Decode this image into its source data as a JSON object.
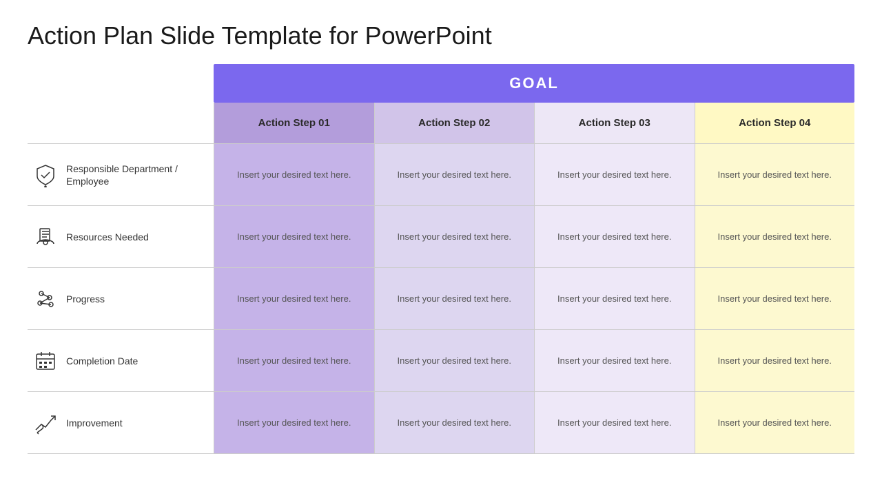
{
  "title": "Action Plan Slide Template for PowerPoint",
  "goal_label": "GOAL",
  "columns": [
    {
      "label": "Action Step 01"
    },
    {
      "label": "Action Step 02"
    },
    {
      "label": "Action Step 03"
    },
    {
      "label": "Action Step 04"
    }
  ],
  "rows": [
    {
      "label": "Responsible Department / Employee",
      "icon": "shield",
      "cells": [
        "Insert your desired text here.",
        "Insert your desired text here.",
        "Insert your desired text here.",
        "Insert your desired text here."
      ]
    },
    {
      "label": "Resources Needed",
      "icon": "resources",
      "cells": [
        "Insert your desired text here.",
        "Insert your desired text here.",
        "Insert your desired text here.",
        "Insert your desired text here."
      ]
    },
    {
      "label": "Progress",
      "icon": "progress",
      "cells": [
        "Insert your desired text here.",
        "Insert your desired text here.",
        "Insert your desired text here.",
        "Insert your desired text here."
      ]
    },
    {
      "label": "Completion Date",
      "icon": "calendar",
      "cells": [
        "Insert your desired text here.",
        "Insert your desired text here.",
        "Insert your desired text here.",
        "Insert your desired text here."
      ]
    },
    {
      "label": "Improvement",
      "icon": "improvement",
      "cells": [
        "Insert your desired text here.",
        "Insert your desired text here.",
        "Insert your desired text here.",
        "Insert your desired text here."
      ]
    }
  ],
  "colors": {
    "goal_bg": "#7b68ee",
    "col1_header": "#b39ddb",
    "col2_header": "#d1c4e9",
    "col3_header": "#ede7f6",
    "col4_header": "#fff9c4"
  }
}
